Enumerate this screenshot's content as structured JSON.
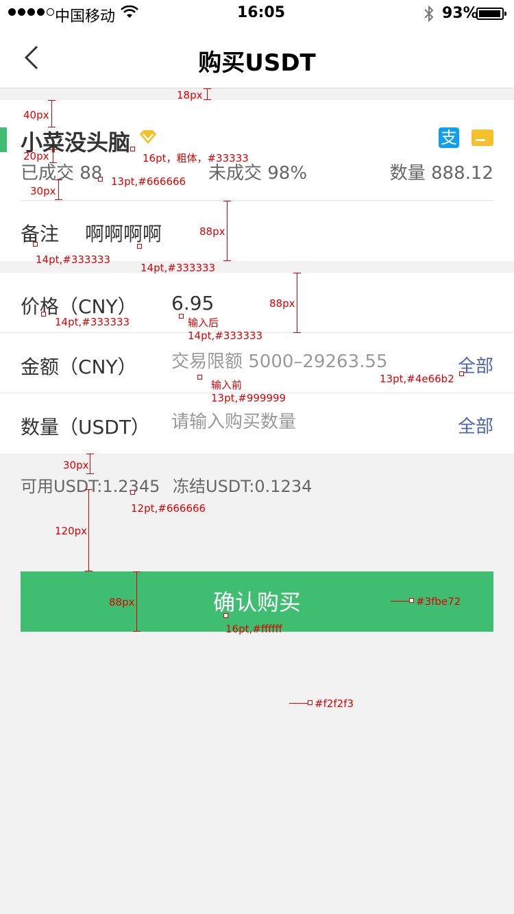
{
  "status_bar": {
    "carrier": "中国移动",
    "time": "16:05",
    "battery_pct": "93%",
    "battery_level": 0.93
  },
  "nav": {
    "title": "购买USDT",
    "back_icon": "chevron-left-icon"
  },
  "seller": {
    "name": "小菜没头脑",
    "badge_icon": "diamond-icon",
    "payment_icons": [
      "alipay-icon",
      "bank-card-icon"
    ],
    "completed": "已成交 88",
    "uncompleted": "未成交 98%",
    "quantity": "数量 888.12"
  },
  "remark": {
    "label": "备注",
    "value": "啊啊啊啊"
  },
  "form": {
    "price_label": "价格（CNY）",
    "price_value": "6.95",
    "amount_label": "金额（CNY）",
    "amount_placeholder": "交易限额 5000–29263.55",
    "amount_all": "全部",
    "qty_label": "数量（USDT）",
    "qty_placeholder": "请输入购买数量",
    "qty_all": "全部"
  },
  "balance": {
    "available": "可用USDT:1.2345",
    "frozen": "冻结USDT:0.1234"
  },
  "confirm_button": "确认购买",
  "colors": {
    "green": "#3fbe72",
    "background": "#f2f2f3",
    "link": "#4e66b2",
    "text_dark": "#333333",
    "text_mid": "#666666",
    "text_light": "#999999"
  },
  "annotations": {
    "a18": "18px",
    "a40": "40px",
    "a20": "20px",
    "a30a": "30px",
    "seller_font": "16pt，粗体，#33333",
    "stat_font": "13pt,#666666",
    "a88a": "88px",
    "remark_label_font": "14pt,#333333",
    "remark_val_font": "14pt,#333333",
    "price_label_font": "14pt,#333333",
    "after_input": "输入后",
    "after_input_font": "14pt,#333333",
    "a88b": "88px",
    "before_input": "输入前",
    "before_input_font": "13pt,#999999",
    "link_font": "13pt,#4e66b2",
    "a30b": "30px",
    "balance_font": "12pt,#666666",
    "a120": "120px",
    "a88c": "88px",
    "btn_color": "#3fbe72",
    "btn_font": "16pt,#ffffff",
    "bg_color": "#f2f2f3"
  }
}
